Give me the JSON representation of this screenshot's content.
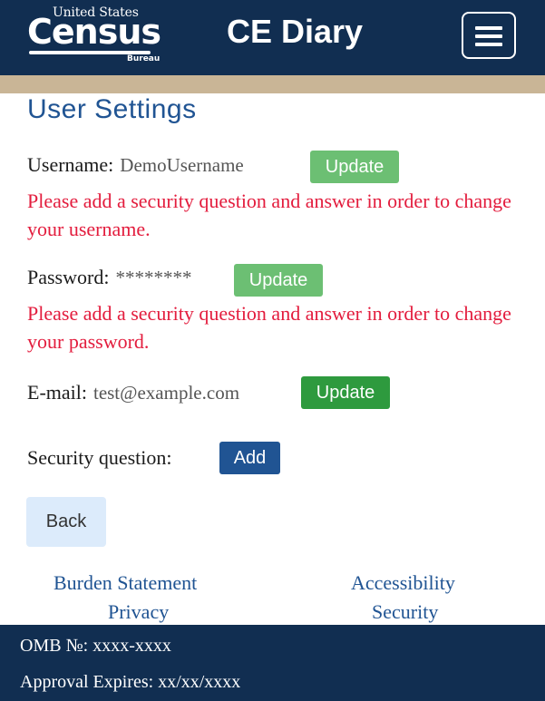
{
  "header": {
    "logo": {
      "line1": "United States",
      "line2": "Census",
      "line3": "Bureau"
    },
    "title": "CE Diary",
    "menu_icon": "hamburger-menu-icon"
  },
  "page_title": "User Settings",
  "username": {
    "label": "Username:",
    "value": "DemoUsername",
    "button": "Update",
    "warning": "Please add a security question and answer in order to change your username."
  },
  "password": {
    "label": "Password:",
    "value": "********",
    "button": "Update",
    "warning": "Please add a security question and answer in order to change your password."
  },
  "email": {
    "label": "E-mail:",
    "value": "test@example.com",
    "button": "Update"
  },
  "security_question": {
    "label": "Security question:",
    "button": "Add"
  },
  "back_button": "Back",
  "links": {
    "burden": "Burden Statement",
    "privacy": "Privacy",
    "accessibility": "Accessibility",
    "security": "Security"
  },
  "footer": {
    "omb": "OMB №: xxxx-xxxx",
    "approval": "Approval Expires: xx/xx/xxxx"
  },
  "colors": {
    "header_bg": "#112e51",
    "tan_band": "#c9b596",
    "title_blue": "#205493",
    "warning_red": "#e31c3d",
    "update_disabled": "#6cbf73",
    "update_enabled": "#2e9a3e",
    "add_button": "#205493",
    "back_button_bg": "#dcebfb"
  }
}
